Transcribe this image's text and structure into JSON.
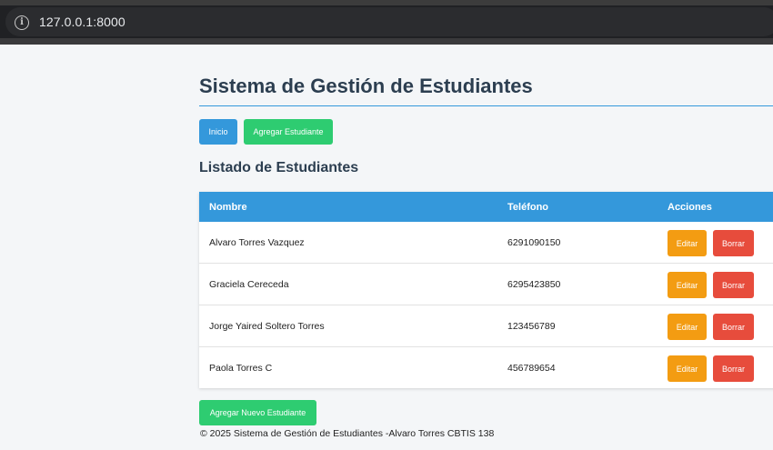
{
  "browser": {
    "url": "127.0.0.1:8000"
  },
  "header": {
    "title": "Sistema de Gestión de Estudiantes"
  },
  "nav": {
    "home_label": "Inicio",
    "add_label": "Agregar Estudiante"
  },
  "list": {
    "title": "Listado de Estudiantes",
    "columns": [
      "Nombre",
      "Teléfono",
      "Acciones"
    ],
    "rows": [
      {
        "nombre": "Alvaro Torres Vazquez",
        "telefono": "6291090150"
      },
      {
        "nombre": "Graciela Cereceda",
        "telefono": "6295423850"
      },
      {
        "nombre": "Jorge Yaired Soltero Torres",
        "telefono": "123456789"
      },
      {
        "nombre": "Paola Torres C",
        "telefono": "456789654"
      }
    ],
    "edit_label": "Editar",
    "delete_label": "Borrar"
  },
  "add_new_label": "Agregar Nuevo Estudiante",
  "footer": {
    "text": "© 2025 Sistema de Gestión de Estudiantes -Alvaro Torres CBTIS 138"
  },
  "colors": {
    "primary": "#3498db",
    "success": "#2ecc71",
    "warning": "#f39c12",
    "danger": "#e74c3c",
    "heading": "#2c3e50"
  }
}
